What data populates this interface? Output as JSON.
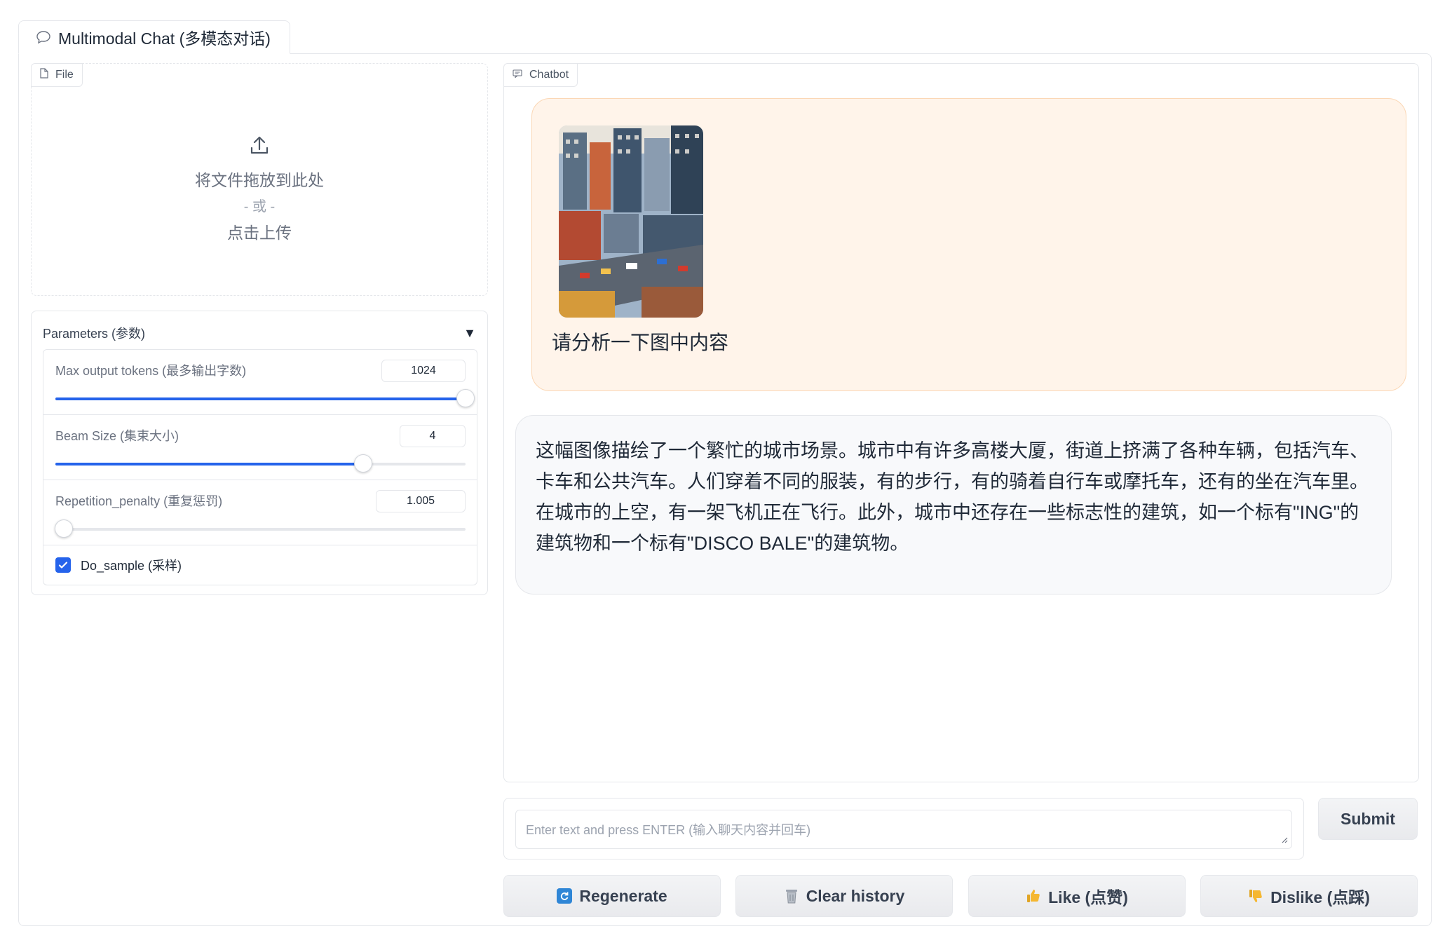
{
  "tab": {
    "label": "Multimodal Chat (多模态对话)"
  },
  "file": {
    "label": "File",
    "drop_text": "将文件拖放到此处",
    "or_text": "- 或 -",
    "click_text": "点击上传"
  },
  "params": {
    "title": "Parameters (参数)",
    "max_tokens": {
      "label": "Max output tokens (最多输出字数)",
      "value": "1024",
      "fraction": 1.0
    },
    "beam_size": {
      "label": "Beam Size (集束大小)",
      "value": "4",
      "fraction": 0.75
    },
    "repetition": {
      "label": "Repetition_penalty (重复惩罚)",
      "value": "1.005",
      "fraction": 0.02
    },
    "do_sample": {
      "label": "Do_sample (采样)",
      "checked": true
    }
  },
  "chatbot": {
    "label": "Chatbot",
    "user_image": "city-illustration",
    "user_text": "请分析一下图中内容",
    "bot_text": "这幅图像描绘了一个繁忙的城市场景。城市中有许多高楼大厦，街道上挤满了各种车辆，包括汽车、卡车和公共汽车。人们穿着不同的服装，有的步行，有的骑着自行车或摩托车，还有的坐在汽车里。在城市的上空，有一架飞机正在飞行。此外，城市中还存在一些标志性的建筑，如一个标有\"ING\"的建筑物和一个标有\"DISCO BALE\"的建筑物。"
  },
  "input": {
    "placeholder": "Enter text and press ENTER (输入聊天内容并回车)"
  },
  "buttons": {
    "submit": "Submit",
    "regenerate": "Regenerate",
    "clear": "Clear history",
    "like": "Like (点赞)",
    "dislike": "Dislike (点踩)"
  },
  "colors": {
    "accent": "#2563eb",
    "user_bubble": "#fff4ea",
    "bot_bubble": "#f8f9fb"
  }
}
